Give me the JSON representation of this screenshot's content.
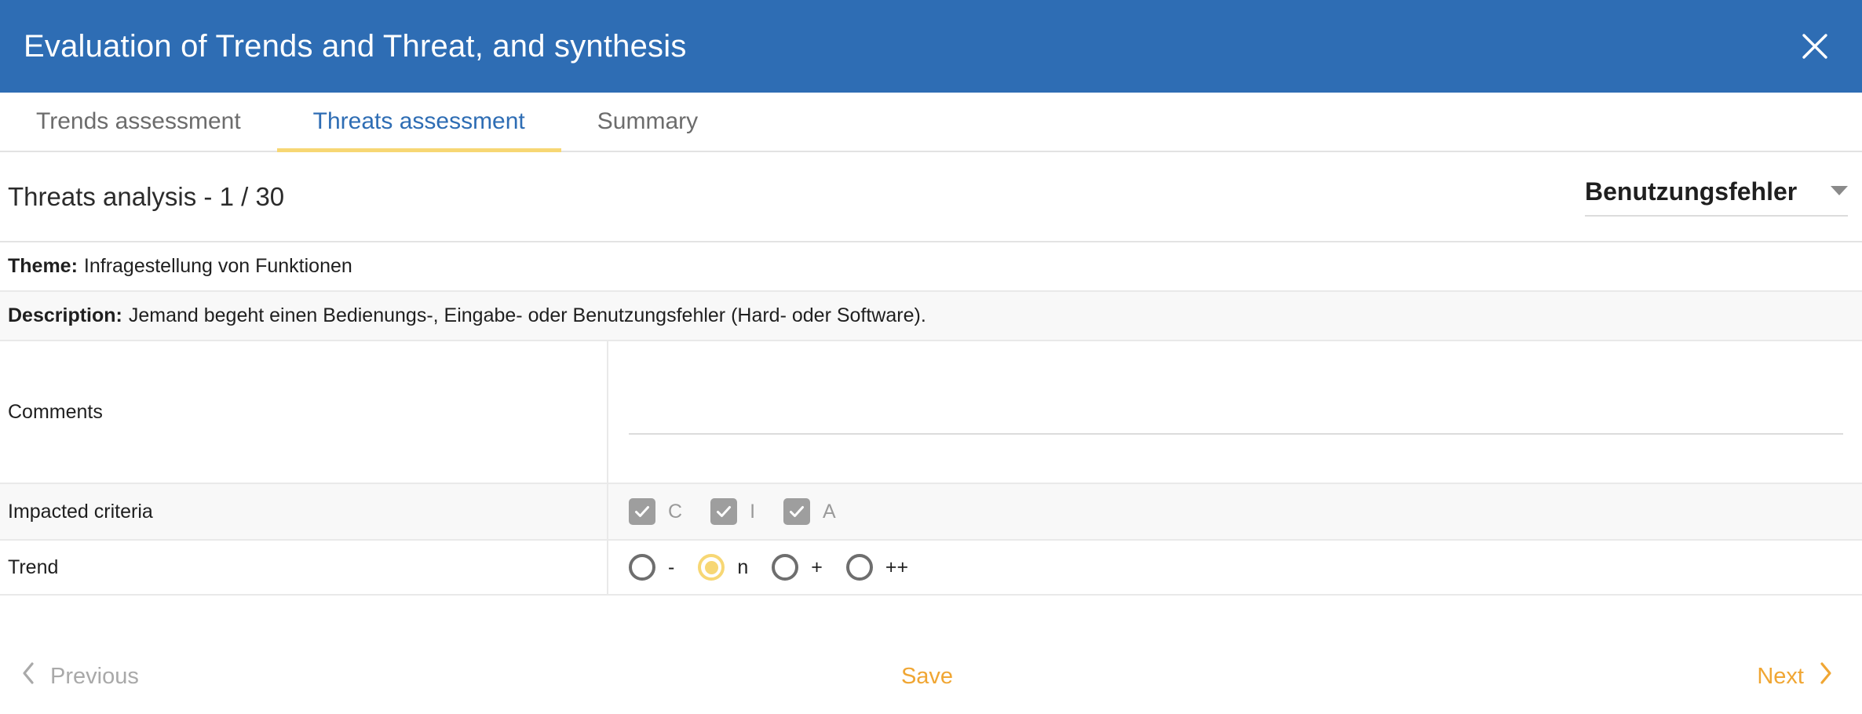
{
  "window": {
    "title": "Evaluation of Trends and Threat, and synthesis",
    "close_icon": "close-icon",
    "header_color": "#2E6DB4"
  },
  "tabs": [
    {
      "label": "Trends assessment",
      "active": false
    },
    {
      "label": "Threats assessment",
      "active": true
    },
    {
      "label": "Summary",
      "active": false
    }
  ],
  "section": {
    "title": "Threats analysis - 1 / 30",
    "current_index": "1",
    "total": "30",
    "category_select": {
      "value": "Benutzungsfehler",
      "caret_icon": "chevron-down-icon"
    }
  },
  "fields": {
    "theme_label": "Theme:",
    "theme_value": "Infragestellung von Funktionen",
    "description_label": "Description:",
    "description_value": "Jemand begeht einen Bedienungs-, Eingabe- oder Benutzungsfehler (Hard- oder Software).",
    "comments_label": "Comments",
    "comments_value": "",
    "comments_placeholder": "",
    "impacted_criteria_label": "Impacted criteria",
    "impacted_criteria": [
      {
        "label": "C",
        "checked": true
      },
      {
        "label": "I",
        "checked": true
      },
      {
        "label": "A",
        "checked": true
      }
    ],
    "trend_label": "Trend",
    "trend_options": [
      {
        "label": "-",
        "selected": false
      },
      {
        "label": "n",
        "selected": true
      },
      {
        "label": "+",
        "selected": false
      },
      {
        "label": "++",
        "selected": false
      }
    ]
  },
  "footer": {
    "previous_label": "Previous",
    "previous_icon": "chevron-left-icon",
    "save_label": "Save",
    "next_label": "Next",
    "next_icon": "chevron-right-icon"
  },
  "colors": {
    "accent_blue": "#2E6DB4",
    "accent_yellow": "#F7D774",
    "accent_orange": "#F0A633",
    "muted_gray": "#9e9e9e"
  }
}
